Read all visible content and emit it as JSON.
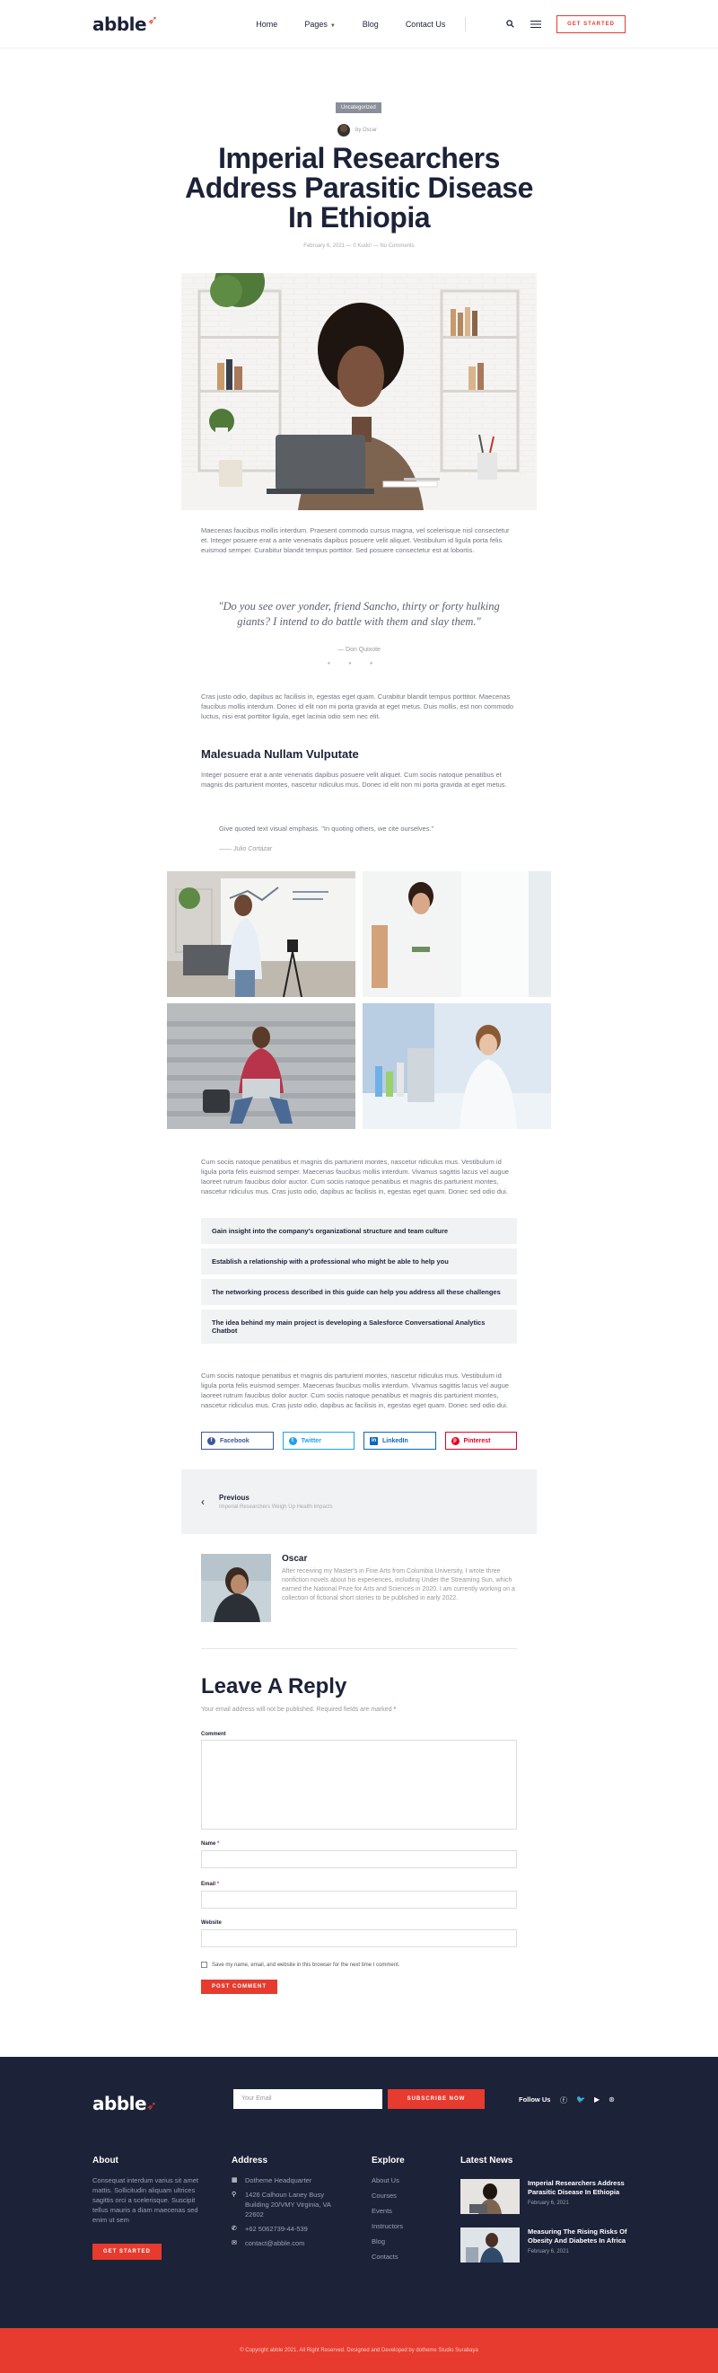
{
  "header": {
    "logo": "abble",
    "nav": [
      {
        "label": "Home"
      },
      {
        "label": "Pages"
      },
      {
        "label": "Blog"
      },
      {
        "label": "Contact Us"
      }
    ],
    "cta": "GET STARTED"
  },
  "post": {
    "category": "Uncategorized",
    "author": "by Oscar",
    "title": "Imperial Researchers Address Parasitic Disease In Ethiopia",
    "meta": "February 6, 2021  —  0 Kudo!  —  No Comments",
    "intro": "Maecenas faucibus mollis interdum. Praesent commodo cursus magna, vel scelerisque nisl consectetur et. Integer posuere erat a ante venenatis dapibus posuere velit aliquet. Vestibulum id ligula porta felis euismod semper. Curabitur blandit tempus porttitor. Sed posuere consectetur est at lobortis.",
    "quote": "\"Do you see over yonder, friend Sancho, thirty or forty hulking giants? I intend to do battle with them and slay them.\"",
    "quote_author": "— Don Quixote",
    "para2": "Cras justo odio, dapibus ac facilisis in, egestas eget quam. Curabitur blandit tempus porttitor. Maecenas faucibus mollis interdum. Donec id elit non mi porta gravida at eget metus. Duis mollis, est non commodo luctus, nisi erat porttitor ligula, eget lacinia odio sem nec elit.",
    "subheading": "Malesuada Nullam Vulputate",
    "para3": "Integer posuere erat a ante venenatis dapibus posuere velit aliquet. Cum sociis natoque penatibus et magnis dis parturient montes, nascetur ridiculus mus. Donec id elit non mi porta gravida at eget metus.",
    "blockquote": "Give quoted text visual emphasis. \"In quoting others, we cite ourselves.\"",
    "blockquote_author": "—— Julio Cortázar",
    "para4": "Cum sociis natoque penatibus et magnis dis parturient montes, nascetur ridiculus mus. Vestibulum id ligula porta felis euismod semper. Maecenas faucibus mollis interdum. Vivamus sagittis lacus vel augue laoreet rutrum faucibus dolor auctor. Cum sociis natoque penatibus et magnis dis parturient montes, nascetur ridiculus mus. Cras justo odio, dapibus ac facilisis in, egestas eget quam. Donec sed odio dui.",
    "checklist": [
      "Gain insight into the company's organizational structure and team culture",
      "Establish a relationship with a professional who might be able to help you",
      "The networking process described in this guide can help you address all these challenges",
      "The idea behind my main project is developing a Salesforce Conversational Analytics Chatbot"
    ],
    "para5": "Cum sociis natoque penatibus et magnis dis parturient montes, nascetur ridiculus mus. Vestibulum id ligula porta felis euismod semper. Maecenas faucibus mollis interdum. Vivamus sagittis lacus vel augue laoreet rutrum faucibus dolor auctor. Cum sociis natoque penatibus et magnis dis parturient montes, nascetur ridiculus mus. Cras justo odio, dapibus ac facilisis in, egestas eget quam. Donec sed odio dui."
  },
  "share": [
    {
      "label": "Facebook",
      "color": "#3b5998",
      "icon": "facebook-icon"
    },
    {
      "label": "Twitter",
      "color": "#1da1f2",
      "icon": "twitter-icon"
    },
    {
      "label": "LinkedIn",
      "color": "#0a66c2",
      "icon": "linkedin-icon"
    },
    {
      "label": "Pinterest",
      "color": "#e60023",
      "icon": "pinterest-icon"
    }
  ],
  "prev": {
    "label": "Previous",
    "title": "Imperial Researchers Weigh Up Health Impacts"
  },
  "bio": {
    "name": "Oscar",
    "text": "After receiving my Master's in Fine Arts from Columbia University, I wrote three nonfiction novels about his experiences, including Under the Streaming Sun, which earned the National Prize for Arts and Sciences in 2020. I am currently working on a collection of fictional short stories to be published in early 2022."
  },
  "reply": {
    "title": "Leave A Reply",
    "note": "Your email address will not be published. Required fields are marked",
    "req": "*",
    "comment_label": "Comment",
    "name_label": "Name",
    "email_label": "Email",
    "website_label": "Website",
    "save_label": "Save my name, email, and website in this browser for the next time I comment.",
    "submit": "POST COMMENT"
  },
  "footer": {
    "logo": "abble",
    "email_placeholder": "Your Email",
    "subscribe": "SUBSCRIBE NOW",
    "follow": "Follow Us",
    "about_title": "About",
    "about_text": "Consequat interdum varius sit amet mattis. Sollicitudin aliquam ultrices sagittis orci a scelerisque. Suscipit tellus mauris a diam maecenas sed enim ut sem",
    "about_btn": "GET STARTED",
    "address_title": "Address",
    "address": [
      {
        "icon": "building-icon",
        "text": "Dotheme Headquarter"
      },
      {
        "icon": "pin-icon",
        "text": "1426 Calhoun Laney Busy Building 20/VMY Virginia, VA 22602"
      },
      {
        "icon": "phone-icon",
        "text": "+62 5062739-44-539"
      },
      {
        "icon": "chat-icon",
        "text": "contact@abble.com"
      }
    ],
    "explore_title": "Explore",
    "explore": [
      "About Us",
      "Courses",
      "Events",
      "Instructors",
      "Blog",
      "Contacts"
    ],
    "news_title": "Latest News",
    "news": [
      {
        "title": "Imperial Researchers Address Parasitic Disease In Ethiopia",
        "date": "February 6, 2021"
      },
      {
        "title": "Measuring The Rising Risks Of Obesity And Diabetes In Africa",
        "date": "February 6, 2021"
      }
    ],
    "copyright": "© Copyright abble 2021. All Right Reserved. Designed and Developed by dotheme Studio Surabaya"
  }
}
